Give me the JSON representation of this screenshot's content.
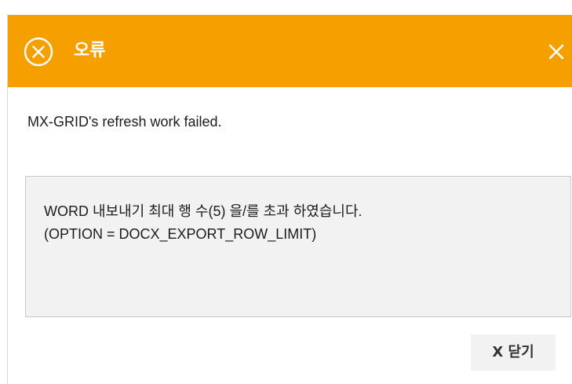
{
  "dialog": {
    "title": "오류",
    "title_icon": "error-circle-x-icon",
    "close_icon": "close-icon",
    "header_color": "#f5a000",
    "message": "MX-GRID's refresh work failed.",
    "detail_lines": [
      "WORD 내보내기 최대 행 수(5) 을/를 초과 하였습니다.",
      "(OPTION = DOCX_EXPORT_ROW_LIMIT)"
    ],
    "close_button_label": "X 닫기"
  }
}
